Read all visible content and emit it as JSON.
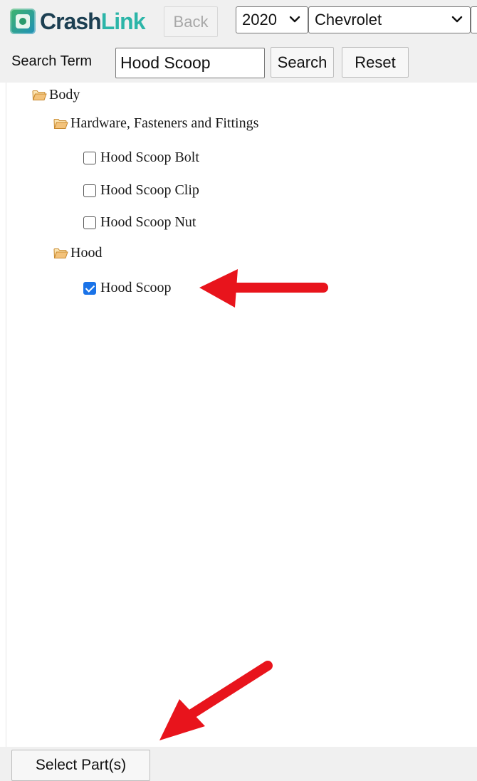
{
  "header": {
    "logo": {
      "text_part1": "Crash",
      "text_part2": "Link",
      "icon": "crashlink-logo-icon"
    },
    "back_label": "Back",
    "year_select": {
      "value": "2020",
      "icon": "chevron-down-icon"
    },
    "make_select": {
      "value": "Chevrolet",
      "icon": "chevron-down-icon"
    }
  },
  "search": {
    "label": "Search Term",
    "value": "Hood Scoop",
    "search_label": "Search",
    "reset_label": "Reset"
  },
  "tree": {
    "root": {
      "label": "Body",
      "icon": "folder-open-icon"
    },
    "groups": [
      {
        "label": "Hardware, Fasteners and Fittings",
        "icon": "folder-open-icon",
        "items": [
          {
            "label": "Hood Scoop Bolt",
            "checked": false
          },
          {
            "label": "Hood Scoop Clip",
            "checked": false
          },
          {
            "label": "Hood Scoop Nut",
            "checked": false
          }
        ]
      },
      {
        "label": "Hood",
        "icon": "folder-open-icon",
        "items": [
          {
            "label": "Hood Scoop",
            "checked": true
          }
        ]
      }
    ]
  },
  "footer": {
    "select_parts_label": "Select Part(s)"
  },
  "colors": {
    "logo_dark": "#1c3f52",
    "logo_accent": "#2cb5a8",
    "checkbox_checked": "#1a73e8",
    "annotation_arrow": "#e8141c",
    "folder": "#f3c27a"
  }
}
